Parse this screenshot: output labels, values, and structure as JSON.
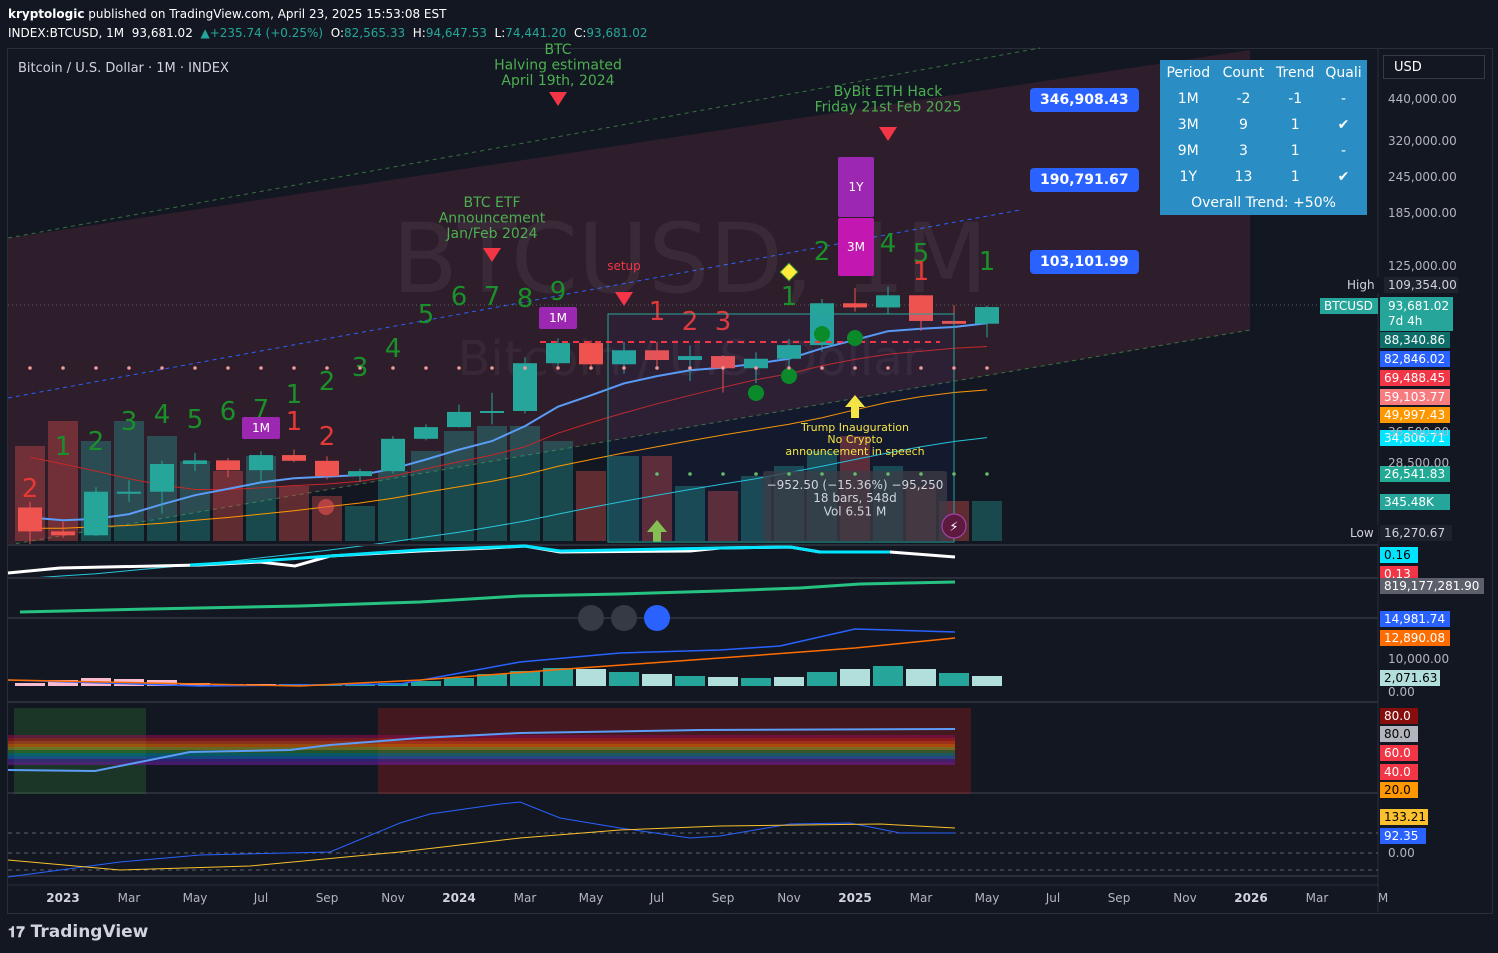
{
  "header": {
    "author": "kryptologic",
    "published": "published on TradingView.com, April 23, 2025 15:53:08 EST",
    "symbol_line": "INDEX:BTCUSD, 1M",
    "last": "93,681.02",
    "change": "+235.74 (+0.25%)",
    "o_label": "O:",
    "o": "82,565.33",
    "h_label": "H:",
    "h": "94,647.53",
    "l_label": "L:",
    "l": "74,441.20",
    "c_label": "C:",
    "c": "93,681.02"
  },
  "chart_title": "Bitcoin / U.S. Dollar · 1M · INDEX",
  "watermark": "BTCUSD, 1M",
  "watermark2": "Bitcoin / U.S. Dollar",
  "currency": "USD",
  "footer_brand": "TradingView",
  "quality_table": {
    "headers": [
      "Period",
      "Count",
      "Trend",
      "Quali"
    ],
    "rows": [
      [
        "1M",
        "-2",
        "-1",
        "-"
      ],
      [
        "3M",
        "9",
        "1",
        "✔"
      ],
      [
        "9M",
        "3",
        "1",
        "-"
      ],
      [
        "1Y",
        "13",
        "1",
        "✔"
      ]
    ],
    "overall": "Overall Trend: +50%"
  },
  "callouts": [
    "346,908.43",
    "190,791.67",
    "103,101.99"
  ],
  "annotations": {
    "halving": [
      "BTC",
      "Halving estimated",
      "April 19th, 2024"
    ],
    "bybit": [
      "ByBit ETH Hack",
      "Friday 21st Feb 2025"
    ],
    "etf": [
      "BTC ETF",
      "Announcement",
      "Jan/Feb 2024"
    ],
    "trump": [
      "Trump Inauguration",
      "No Crypto",
      "announcement in speech"
    ],
    "setup": "setup",
    "measure": [
      "−952.50 (−15.36%) −95,250",
      "18 bars, 548d",
      "Vol 6.51 M"
    ]
  },
  "price_axis": {
    "ticks": [
      "440,000.00",
      "320,000.00",
      "245,000.00",
      "185,000.00",
      "125,000.00"
    ],
    "high_label": "High",
    "high": "109,354.00",
    "symbol": "BTCUSD",
    "price": "93,681.02",
    "countdown": "7d 4h",
    "levels": [
      {
        "v": "88,340.86",
        "c": "#0e6f6a"
      },
      {
        "v": "82,846.02",
        "c": "#2962ff"
      },
      {
        "v": "69,488.45",
        "c": "#f23645"
      },
      {
        "v": "59,103.77",
        "c": "#f77c80"
      },
      {
        "v": "49,997.43",
        "c": "#ff9800"
      },
      {
        "v": "34,806.71",
        "c": "#00e5ff"
      },
      {
        "v": "26,541.83",
        "c": "#22ab94"
      },
      {
        "v": "345.48K",
        "c": "#26a69a"
      }
    ],
    "low_label": "Low",
    "low": "16,270.67",
    "hidden_ticks": [
      "36,500.00",
      "28,500.00"
    ]
  },
  "pane_labels": [
    {
      "v": "0.16",
      "c": "#00e5ff",
      "fg": "#000"
    },
    {
      "v": "0.13",
      "c": "#f23645",
      "fg": "#fff"
    },
    {
      "v": "819,177,281.90",
      "c": "#5d606b",
      "fg": "#fff"
    },
    {
      "v": "14,981.74",
      "c": "#2962ff",
      "fg": "#fff"
    },
    {
      "v": "12,890.08",
      "c": "#ff6d00",
      "fg": "#fff"
    },
    {
      "v": "10,000.00",
      "c": "",
      "fg": "#b2b5be"
    },
    {
      "v": "2,071.63",
      "c": "#b2dfdb",
      "fg": "#000"
    },
    {
      "v": "0.00",
      "c": "",
      "fg": "#b2b5be"
    },
    {
      "v": "80.0",
      "c": "#880e0e",
      "fg": "#fff"
    },
    {
      "v": "80.0",
      "c": "#b2b5be",
      "fg": "#000"
    },
    {
      "v": "60.0",
      "c": "#f23645",
      "fg": "#fff"
    },
    {
      "v": "40.0",
      "c": "#f23645",
      "fg": "#fff"
    },
    {
      "v": "20.0",
      "c": "#ff9800",
      "fg": "#000"
    },
    {
      "v": "133.21",
      "c": "#fbc02d",
      "fg": "#000"
    },
    {
      "v": "92.35",
      "c": "#2962ff",
      "fg": "#fff"
    },
    {
      "v": "0.00",
      "c": "",
      "fg": "#b2b5be"
    }
  ],
  "time_axis": [
    "2023",
    "Mar",
    "May",
    "Jul",
    "Sep",
    "Nov",
    "2024",
    "Mar",
    "May",
    "Jul",
    "Sep",
    "Nov",
    "2025",
    "Mar",
    "May",
    "Jul",
    "Sep",
    "Nov",
    "2026",
    "Mar",
    "M"
  ],
  "bubbles": [
    "1M",
    "1M",
    "1Y",
    "3M"
  ],
  "chart_data": {
    "type": "candlestick",
    "title": "Bitcoin / U.S. Dollar · 1M · INDEX",
    "y_scale": "log",
    "ylim": [
      15000,
      600000
    ],
    "categories": [
      "2022-11",
      "2022-12",
      "2023-01",
      "2023-02",
      "2023-03",
      "2023-04",
      "2023-05",
      "2023-06",
      "2023-07",
      "2023-08",
      "2023-09",
      "2023-10",
      "2023-11",
      "2023-12",
      "2024-01",
      "2024-02",
      "2024-03",
      "2024-04",
      "2024-05",
      "2024-06",
      "2024-07",
      "2024-08",
      "2024-09",
      "2024-10",
      "2024-11",
      "2024-12",
      "2025-01",
      "2025-02",
      "2025-03",
      "2025-04"
    ],
    "ohlc": [
      [
        20500,
        21400,
        15500,
        17100
      ],
      [
        17100,
        18400,
        16300,
        16600
      ],
      [
        16600,
        23900,
        16500,
        23100
      ],
      [
        23100,
        25200,
        21400,
        23100
      ],
      [
        23100,
        29200,
        19600,
        28500
      ],
      [
        28500,
        31000,
        27000,
        29300
      ],
      [
        29300,
        29800,
        25800,
        27200
      ],
      [
        27200,
        31400,
        24800,
        30500
      ],
      [
        30500,
        31800,
        28900,
        29200
      ],
      [
        29200,
        30200,
        25400,
        26000
      ],
      [
        26000,
        27500,
        24900,
        27000
      ],
      [
        27000,
        35200,
        26500,
        34500
      ],
      [
        34500,
        38500,
        34100,
        37700
      ],
      [
        37700,
        44700,
        37600,
        42300
      ],
      [
        42300,
        48900,
        38500,
        42600
      ],
      [
        42600,
        64000,
        41800,
        61200
      ],
      [
        61200,
        73800,
        59100,
        71300
      ],
      [
        71300,
        72700,
        59200,
        60700
      ],
      [
        60700,
        71900,
        56500,
        67500
      ],
      [
        67500,
        71900,
        58400,
        62700
      ],
      [
        62700,
        70000,
        53500,
        64600
      ],
      [
        64600,
        65100,
        49000,
        58900
      ],
      [
        58900,
        66500,
        52600,
        63300
      ],
      [
        63300,
        73600,
        58900,
        70200
      ],
      [
        70200,
        99600,
        66800,
        96400
      ],
      [
        96400,
        108300,
        90500,
        93400
      ],
      [
        93400,
        109354,
        89200,
        102400
      ],
      [
        102400,
        102500,
        78200,
        84300
      ],
      [
        84300,
        95000,
        76600,
        82500
      ],
      [
        82565,
        94647,
        74441,
        93681
      ]
    ],
    "series_levels": {
      "ema_blue": 82846.02,
      "sma_red": 69488.45,
      "sma_orange": 49997.43,
      "sma_cyan": 34806.71
    },
    "td_counts_green": [
      "1",
      "2",
      "3",
      "4",
      "5",
      "6",
      "7",
      "1",
      "2",
      "3",
      "4",
      "5",
      "6",
      "7",
      "8",
      "9",
      "2",
      "3",
      "4",
      "5",
      "1"
    ],
    "td_counts_red": [
      "2",
      "1",
      "2",
      "1",
      "2",
      "3",
      "1"
    ],
    "volume_label": "345.48K"
  }
}
